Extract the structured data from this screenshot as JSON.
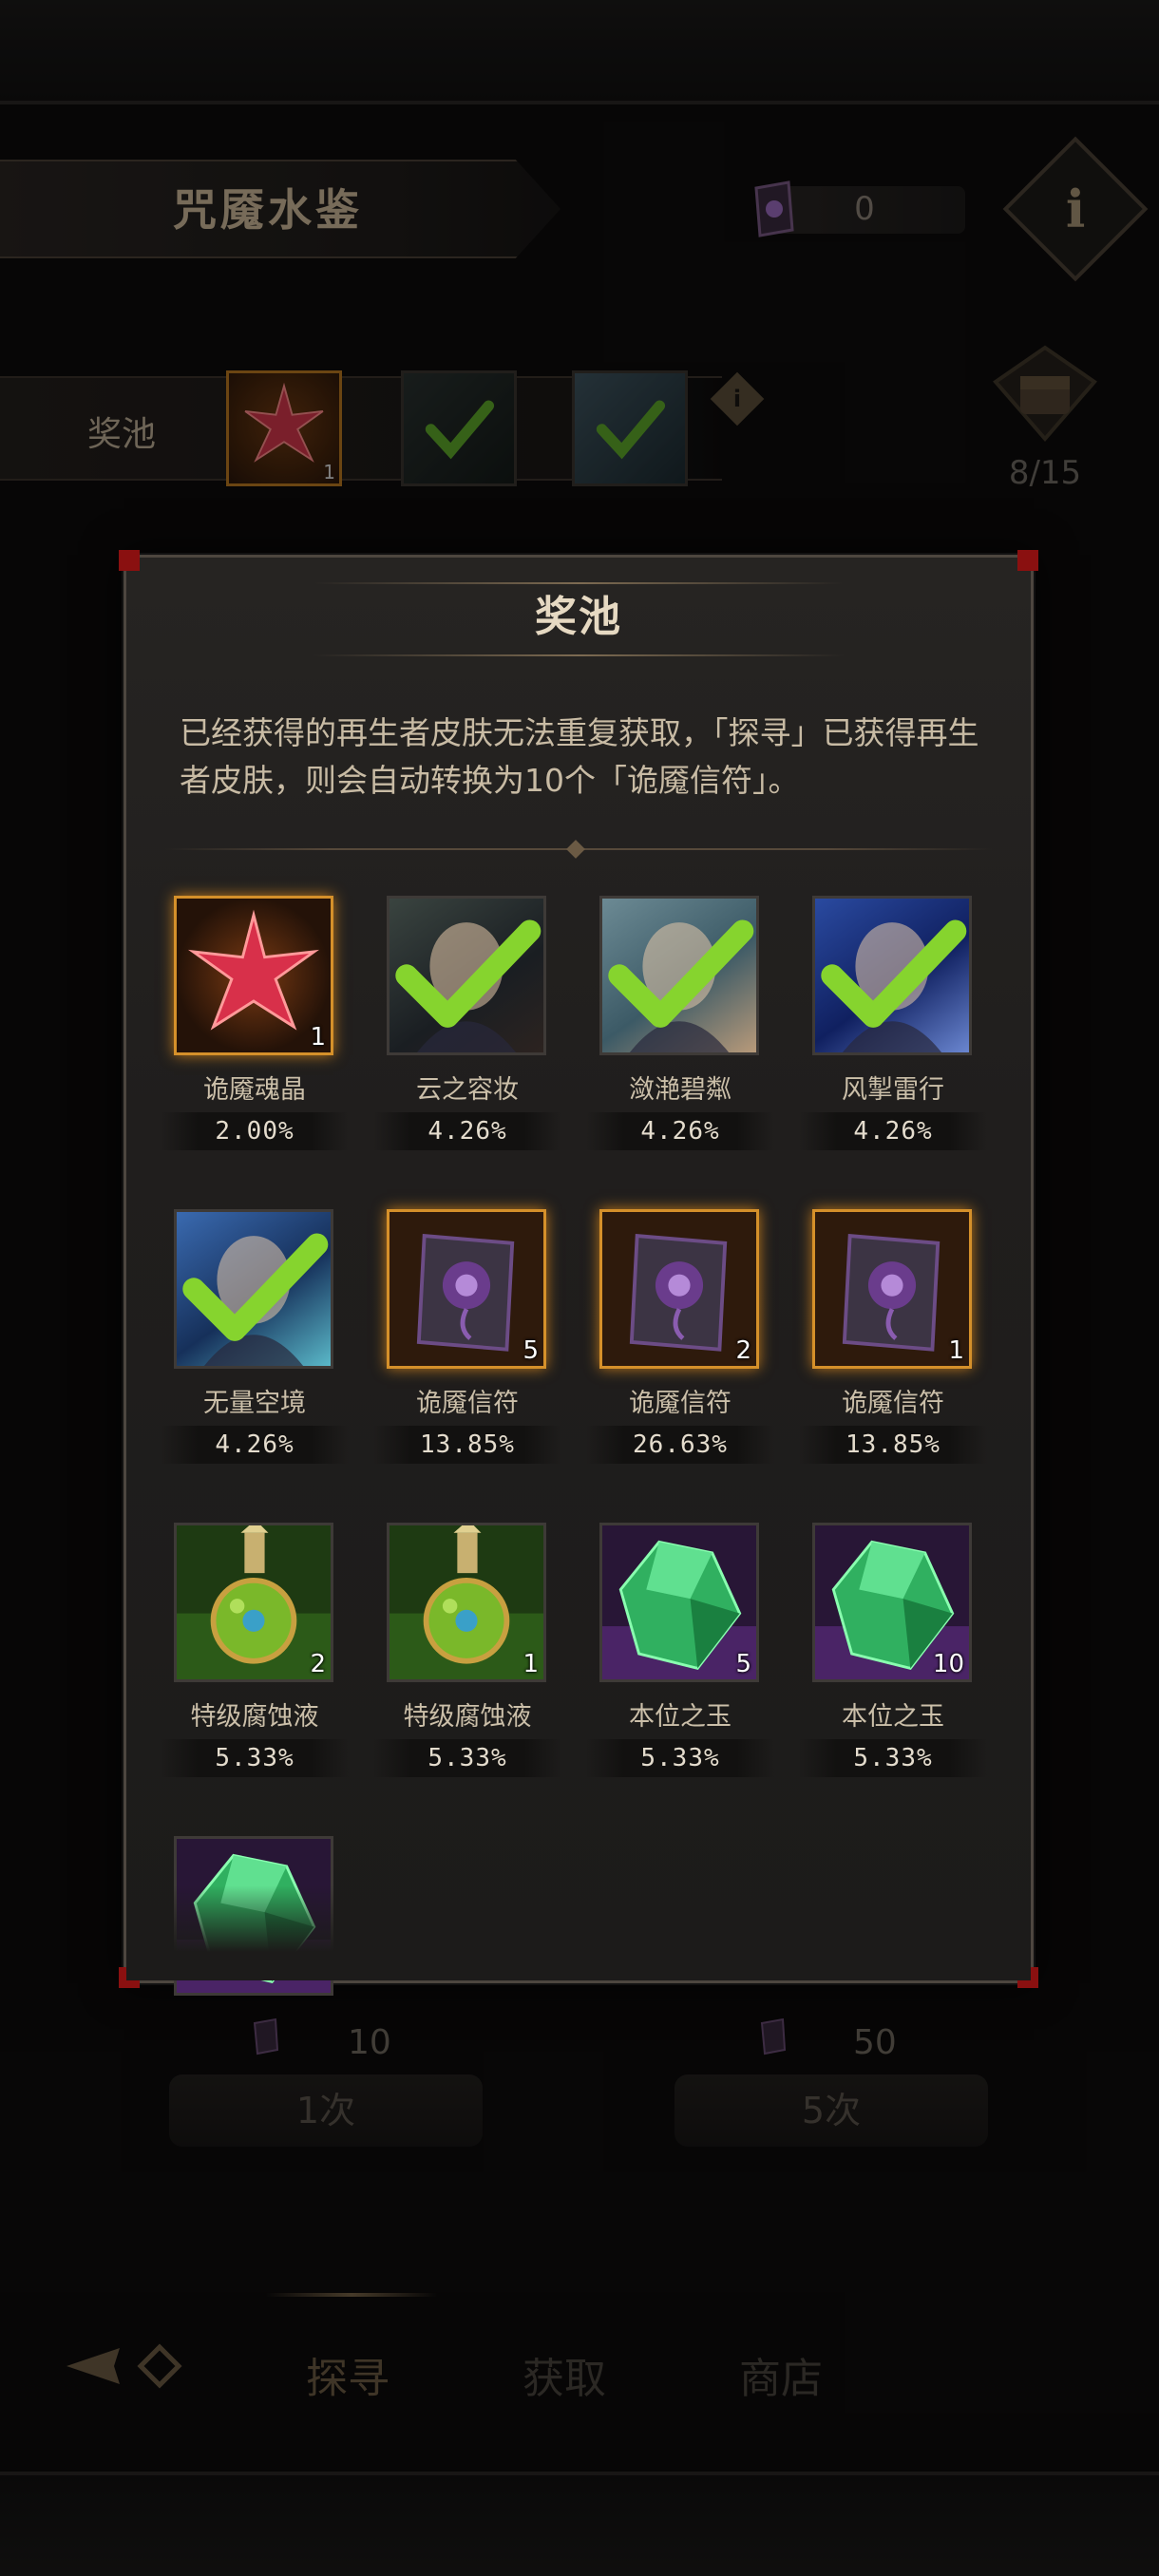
{
  "header": {
    "title": "咒魇水鉴",
    "currency_value": "0",
    "info_icon": "info-icon"
  },
  "pool_bar": {
    "label": "奖池",
    "info_icon": "info-icon",
    "chest_count": "8/15",
    "first_qty": "1"
  },
  "modal": {
    "title": "奖池",
    "description": "已经获得的再生者皮肤无法重复获取，「探寻」已获得再生者皮肤，则会自动转换为10个「诡魇信符」。",
    "items": [
      {
        "name": "诡魇魂晶",
        "rate": "2.00%",
        "qty": "1",
        "icon": "star-crystal-icon",
        "owned": false
      },
      {
        "name": "云之容妆",
        "rate": "4.26%",
        "qty": "",
        "icon": "skin-portrait-icon",
        "owned": true
      },
      {
        "name": "潋滟碧粼",
        "rate": "4.26%",
        "qty": "",
        "icon": "skin-portrait-icon",
        "owned": true
      },
      {
        "name": "风掣雷行",
        "rate": "4.26%",
        "qty": "",
        "icon": "skin-portrait-icon",
        "owned": true
      },
      {
        "name": "无量空境",
        "rate": "4.26%",
        "qty": "",
        "icon": "skin-portrait-icon",
        "owned": true
      },
      {
        "name": "诡魇信符",
        "rate": "13.85%",
        "qty": "5",
        "icon": "talisman-card-icon",
        "owned": false
      },
      {
        "name": "诡魇信符",
        "rate": "26.63%",
        "qty": "2",
        "icon": "talisman-card-icon",
        "owned": false
      },
      {
        "name": "诡魇信符",
        "rate": "13.85%",
        "qty": "1",
        "icon": "talisman-card-icon",
        "owned": false
      },
      {
        "name": "特级腐蚀液",
        "rate": "5.33%",
        "qty": "2",
        "icon": "potion-flask-icon",
        "owned": false
      },
      {
        "name": "特级腐蚀液",
        "rate": "5.33%",
        "qty": "1",
        "icon": "potion-flask-icon",
        "owned": false
      },
      {
        "name": "本位之玉",
        "rate": "5.33%",
        "qty": "5",
        "icon": "green-gem-icon",
        "owned": false
      },
      {
        "name": "本位之玉",
        "rate": "5.33%",
        "qty": "10",
        "icon": "green-gem-icon",
        "owned": false
      },
      {
        "name": "",
        "rate": "",
        "qty": "",
        "icon": "green-gem-icon",
        "owned": false
      }
    ]
  },
  "draw": {
    "single": {
      "cost": "10",
      "label": "1次"
    },
    "multi": {
      "cost": "50",
      "label": "5次"
    }
  },
  "nav": {
    "tabs": [
      "探寻",
      "获取",
      "商店"
    ],
    "active": 0
  },
  "colors": {
    "accent_gold": "#d5902a",
    "check_green": "#7fcf2a",
    "modal_bg": "#201e1d",
    "corner_red": "#8a1010"
  }
}
